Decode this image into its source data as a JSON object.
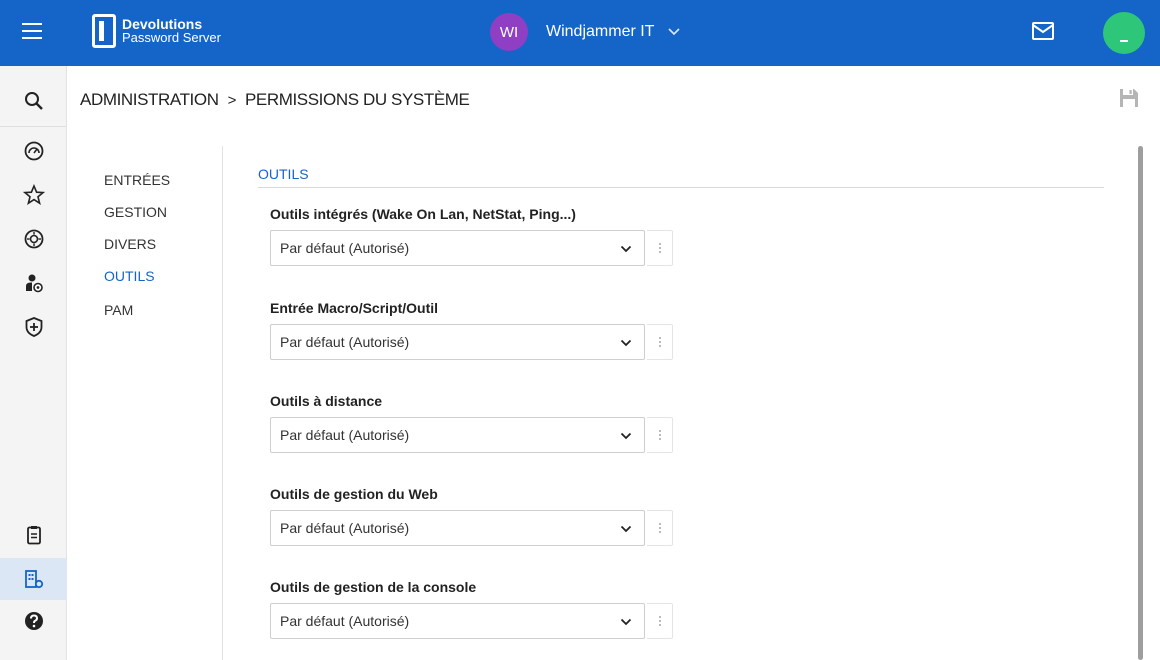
{
  "header": {
    "brand": "Devolutions",
    "product": "Password Server",
    "workspace_initials": "WI",
    "workspace_name": "Windjammer IT",
    "icons": [
      "menu-icon",
      "envelope-icon",
      "user-avatar"
    ],
    "colors": {
      "bar": "#1565c8",
      "workspace_avatar": "#8e3fc4",
      "user_avatar": "#2ec77a"
    }
  },
  "rail": {
    "items": [
      "search-icon",
      "dashboard-icon",
      "star-icon",
      "vault-icon",
      "user-roles-icon",
      "shield-icon",
      "clipboard-icon",
      "administration-icon",
      "help-icon"
    ],
    "active": "administration-icon"
  },
  "breadcrumb": {
    "root": "ADMINISTRATION",
    "separator": ">",
    "current": "PERMISSIONS DU SYSTÈME"
  },
  "subnav": {
    "items": [
      {
        "label": "ENTRÉES"
      },
      {
        "label": "GESTION"
      },
      {
        "label": "DIVERS"
      },
      {
        "label": "OUTILS"
      },
      {
        "label": "PAM"
      }
    ],
    "active": "OUTILS"
  },
  "section": {
    "title": "OUTILS",
    "fields": [
      {
        "label": "Outils intégrés (Wake On Lan, NetStat, Ping...)",
        "value": "Par défaut (Autorisé)"
      },
      {
        "label": "Entrée Macro/Script/Outil",
        "value": "Par défaut (Autorisé)"
      },
      {
        "label": "Outils à distance",
        "value": "Par défaut (Autorisé)"
      },
      {
        "label": "Outils de gestion du Web",
        "value": "Par défaut (Autorisé)"
      },
      {
        "label": "Outils de gestion de la console",
        "value": "Par défaut (Autorisé)"
      }
    ]
  }
}
